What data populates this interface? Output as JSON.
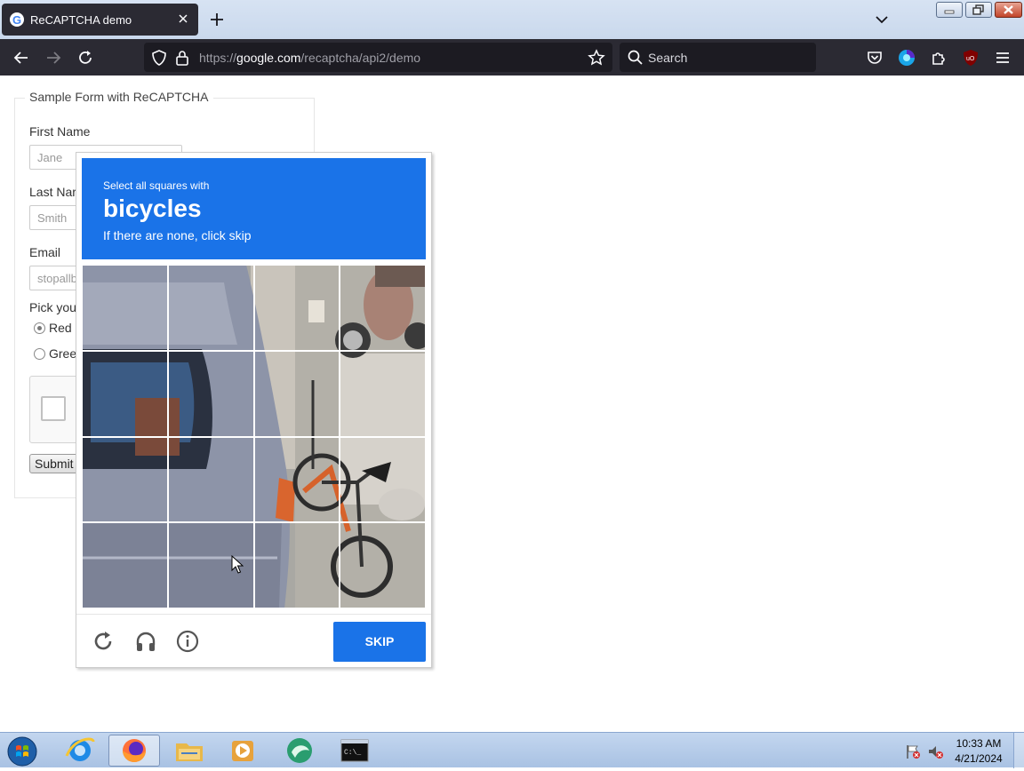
{
  "browser": {
    "tab_title": "ReCAPTCHA demo",
    "url_scheme": "https://",
    "url_host": "google.com",
    "url_path": "/recaptcha/api2/demo",
    "search_placeholder": "Search"
  },
  "form": {
    "legend": "Sample Form with ReCAPTCHA",
    "first_name_label": "First Name",
    "first_name_value": "Jane",
    "last_name_label": "Last Nar",
    "last_name_value": "Smith",
    "email_label": "Email",
    "email_value": "stopallb",
    "color_label": "Pick you",
    "colors": [
      "Red",
      "Gree"
    ],
    "selected_color": "Red",
    "submit_label": "Submit"
  },
  "captcha": {
    "instruction": "Select all squares with",
    "object": "bicycles",
    "hint": "If there are none, click skip",
    "grid_size": 4,
    "skip_label": "SKIP",
    "accent_color": "#1a73e8"
  },
  "taskbar": {
    "time": "10:33 AM",
    "date": "4/21/2024",
    "apps": [
      "internet-explorer",
      "firefox",
      "file-explorer",
      "media-player",
      "app",
      "command-prompt"
    ]
  }
}
